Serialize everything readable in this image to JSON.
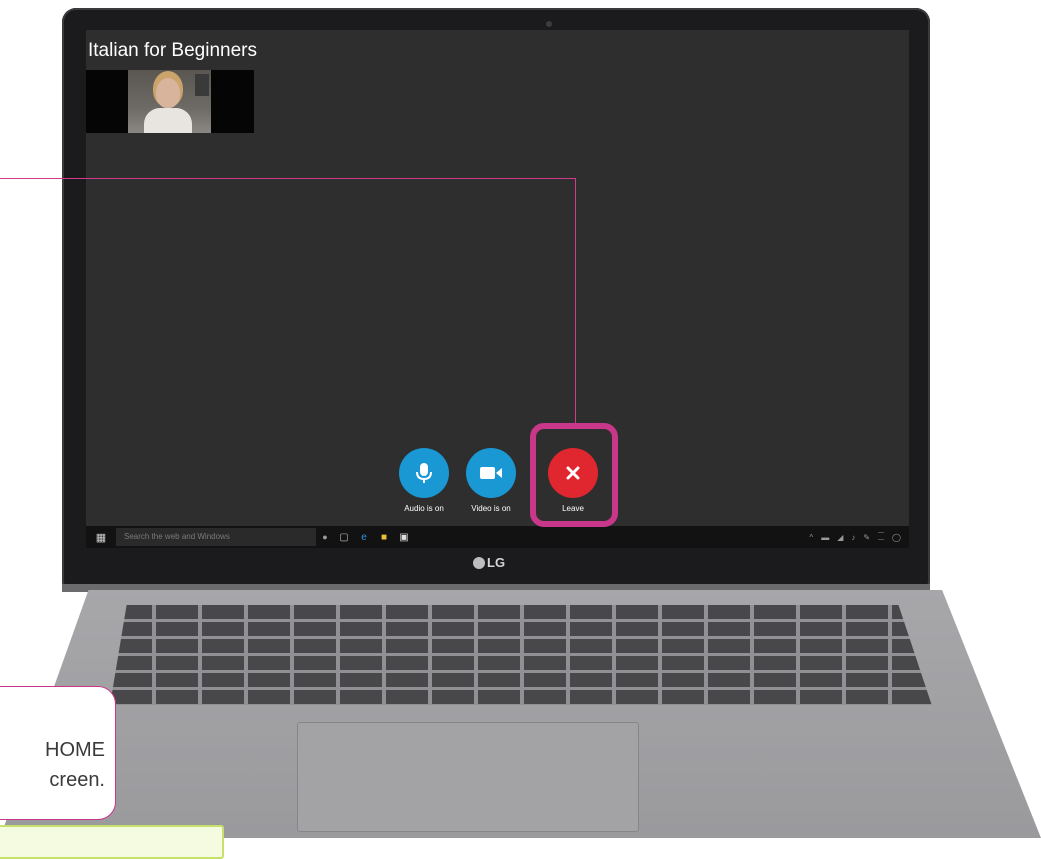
{
  "call": {
    "title": "Italian for Beginners"
  },
  "controls": {
    "audio": {
      "label": "Audio is on",
      "icon": "microphone-icon",
      "color": "#1998d4"
    },
    "video": {
      "label": "Video is on",
      "icon": "video-camera-icon",
      "color": "#1998d4"
    },
    "leave": {
      "label": "Leave",
      "icon": "close-icon",
      "color": "#e0262f"
    }
  },
  "taskbar": {
    "search_placeholder": "Search the web and Windows"
  },
  "device": {
    "brand": "LG"
  },
  "annotation": {
    "highlight_color": "#c8378a",
    "instruction_line1": "HOME",
    "instruction_line2": "creen."
  }
}
